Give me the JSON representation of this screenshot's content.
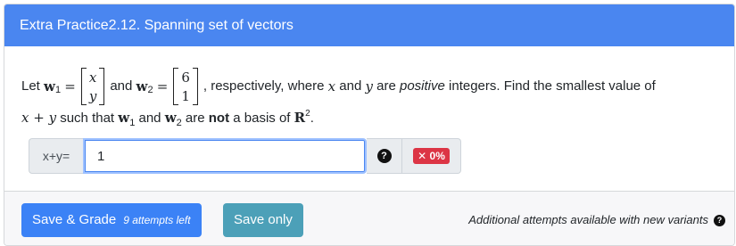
{
  "header": {
    "title": "Extra Practice2.12. Spanning set of vectors"
  },
  "question": {
    "intro": "Let",
    "w1_symbol": "w",
    "w1_sub": "1",
    "equals": "=",
    "w1_top": "x",
    "w1_bottom": "y",
    "and1": "and",
    "w2_symbol": "w",
    "w2_sub": "2",
    "w2_top": "6",
    "w2_bottom": "1",
    "text_a": ", respectively, where",
    "var_x": "x",
    "and2": "and",
    "var_y": "y",
    "are": "are",
    "positive": "positive",
    "text_b": "integers. Find the smallest value of",
    "expr": "x + y",
    "such_that": "such that",
    "and3": "and",
    "are2": "are",
    "not": "not",
    "basis_text": "a basis of",
    "space": "R",
    "space_exp": "2",
    "period": "."
  },
  "answer": {
    "prefix": "x+y=",
    "value": "1",
    "score": "✕ 0%"
  },
  "footer": {
    "save_grade": "Save & Grade",
    "attempts_left": "9 attempts left",
    "save_only": "Save only",
    "note": "Additional attempts available with new variants"
  }
}
